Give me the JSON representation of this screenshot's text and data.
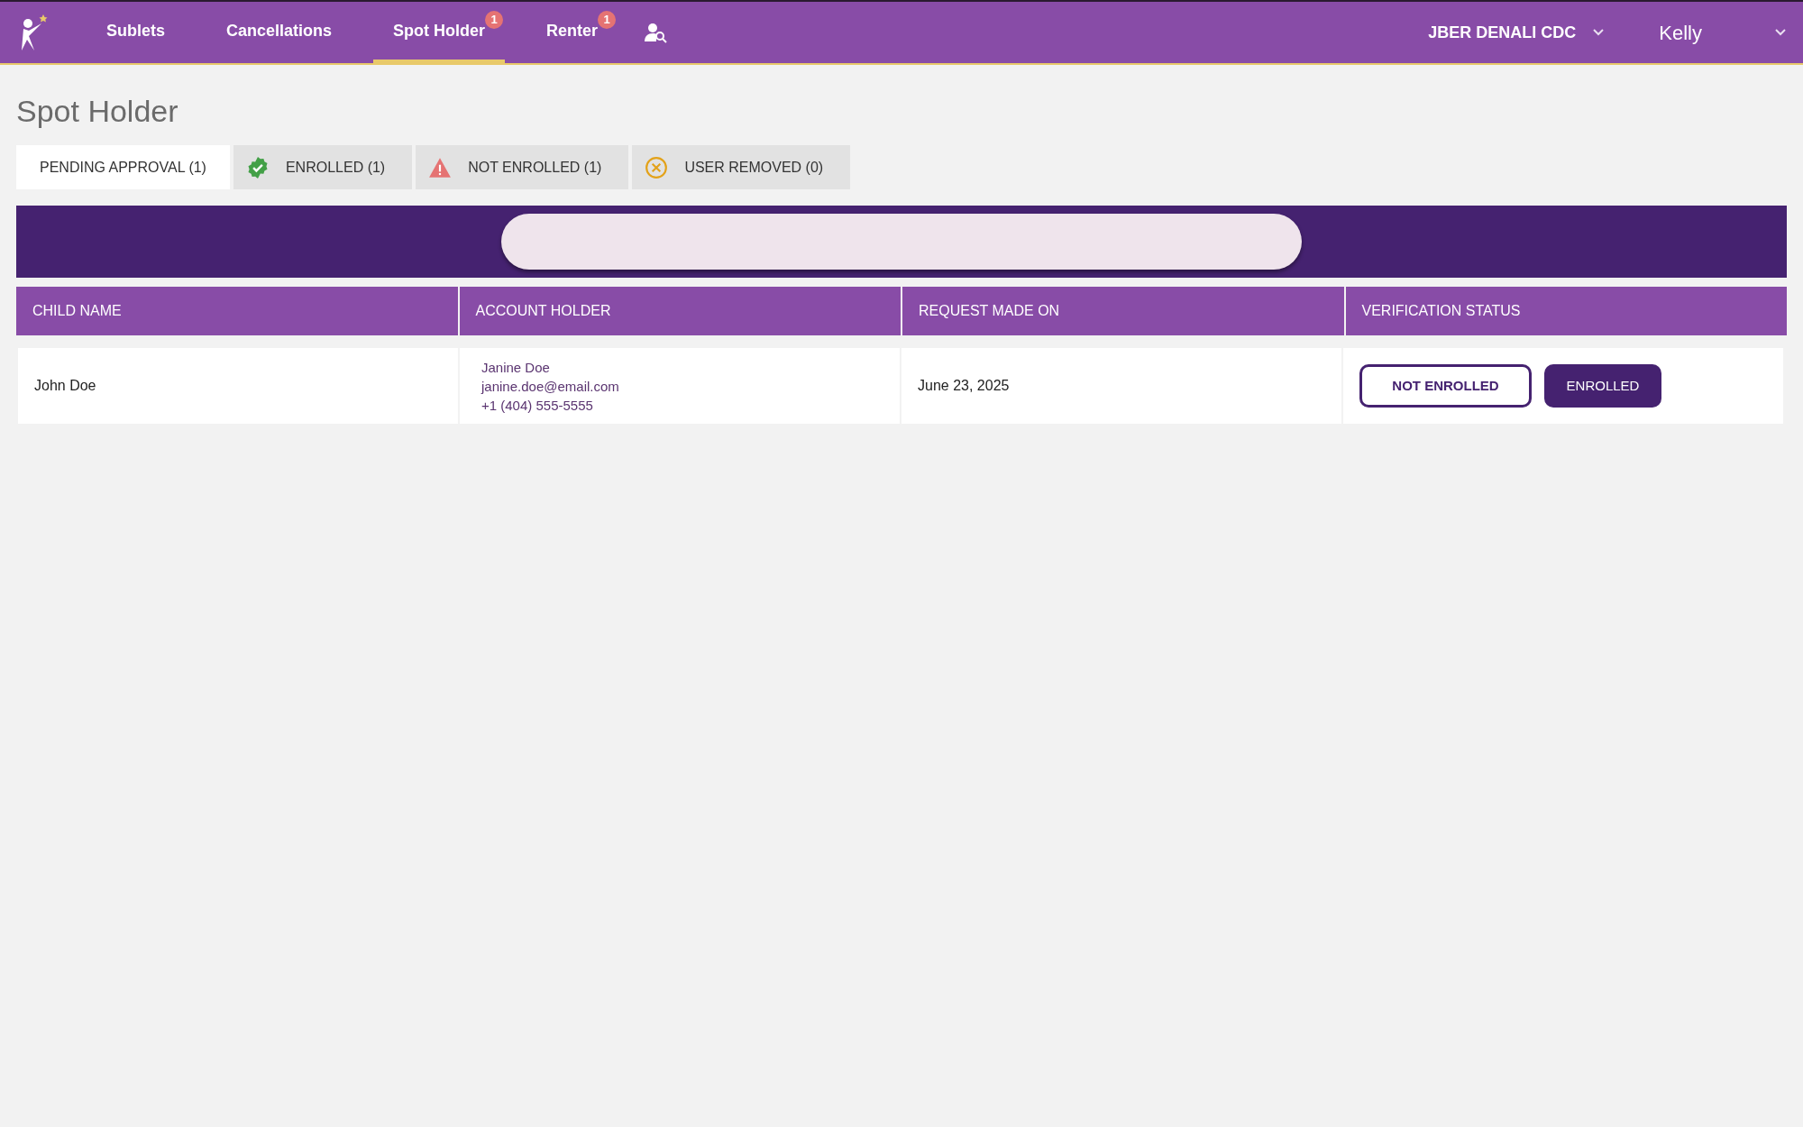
{
  "nav": {
    "items": [
      {
        "label": "Sublets",
        "selected": false
      },
      {
        "label": "Cancellations",
        "selected": false
      },
      {
        "label": "Spot Holder",
        "selected": true,
        "badge": "1"
      },
      {
        "label": "Renter",
        "selected": false,
        "badge": "1"
      }
    ],
    "location": "JBER DENALI CDC",
    "user": "Kelly"
  },
  "page_title": "Spot Holder",
  "filter_tabs": [
    {
      "label": "PENDING APPROVAL (1)",
      "selected": true,
      "kind": "pending"
    },
    {
      "label": "ENROLLED (1)",
      "selected": false,
      "kind": "enrolled"
    },
    {
      "label": "NOT ENROLLED (1)",
      "selected": false,
      "kind": "unenrolled"
    },
    {
      "label": "USER REMOVED (0)",
      "selected": false,
      "kind": "removed"
    }
  ],
  "table": {
    "columns": [
      "CHILD NAME",
      "ACCOUNT HOLDER",
      "REQUEST MADE ON",
      "VERIFICATION STATUS"
    ],
    "rows": [
      {
        "child": "John Doe",
        "holder": [
          "Janine Doe",
          "janine.doe@email.com",
          "+1 (404) 555-5555"
        ],
        "date": "June 23, 2025",
        "actions": [
          {
            "label": "NOT ENROLLED",
            "kind": "outline"
          },
          {
            "label": "ENROLLED",
            "kind": "filled"
          }
        ]
      }
    ]
  }
}
